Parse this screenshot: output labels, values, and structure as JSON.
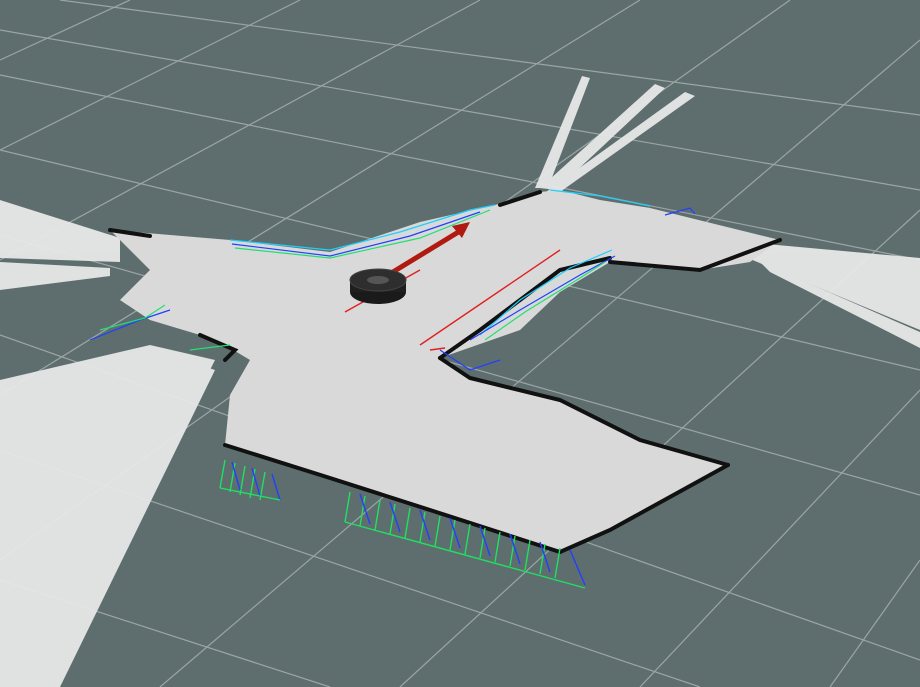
{
  "viewport": {
    "background": "#5e6e6e",
    "grid_color": "#a0a8a8",
    "map_color": "#d9d9d9",
    "wall_color": "#111111",
    "robot_color": "#2a2a2a",
    "pose_arrow_color": "#b01a10",
    "axis_colors": {
      "x": "#e02020",
      "y": "#20d040",
      "z": "#2030ff"
    },
    "scan_ray_color": "#ebebeb",
    "icons": [
      "robot-icon",
      "pose-arrow-icon",
      "tf-axes-icon"
    ]
  }
}
